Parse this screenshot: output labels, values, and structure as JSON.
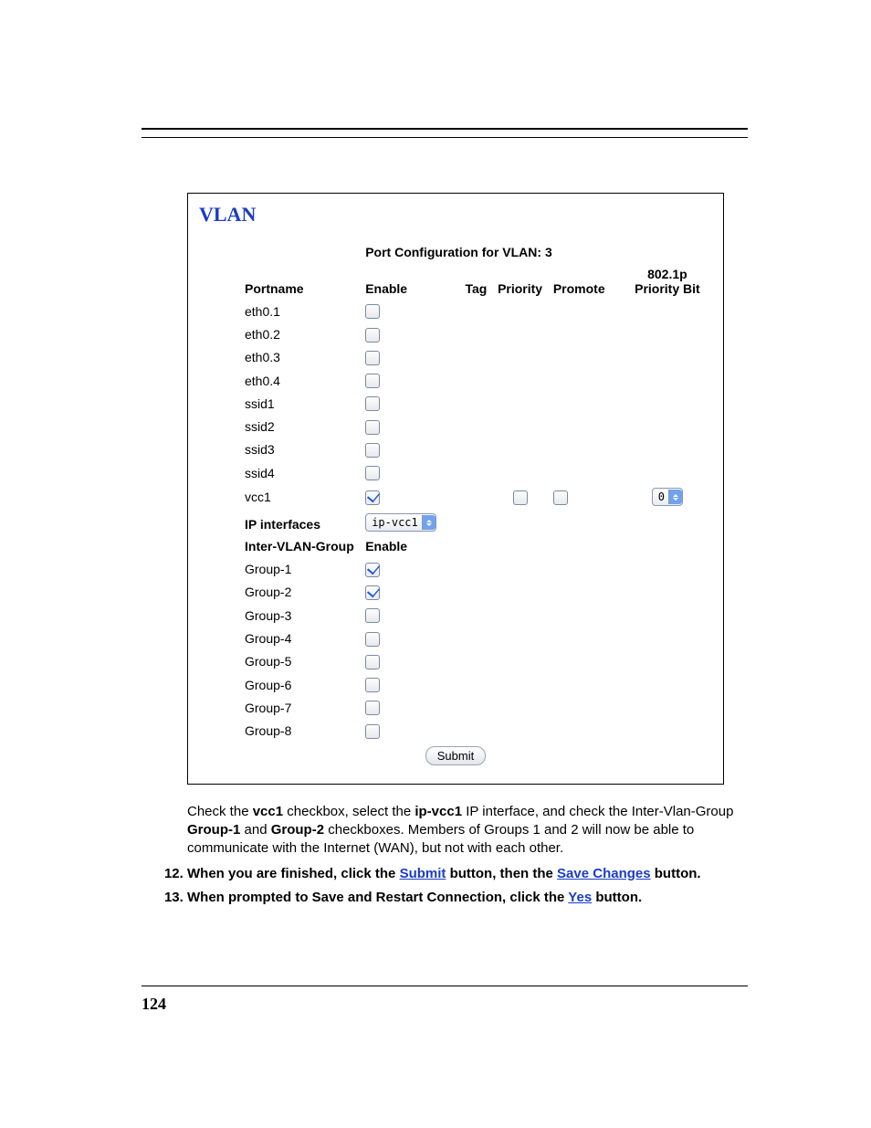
{
  "panel": {
    "title": "VLAN",
    "port_config_caption": "Port Configuration for VLAN: 3",
    "headers": {
      "portname": "Portname",
      "enable": "Enable",
      "tag": "Tag",
      "priority": "Priority",
      "promote": "Promote",
      "bit": "802.1p Priority Bit"
    },
    "ports": [
      {
        "name": "eth0.1",
        "enable": false
      },
      {
        "name": "eth0.2",
        "enable": false
      },
      {
        "name": "eth0.3",
        "enable": false
      },
      {
        "name": "eth0.4",
        "enable": false
      },
      {
        "name": "ssid1",
        "enable": false
      },
      {
        "name": "ssid2",
        "enable": false
      },
      {
        "name": "ssid3",
        "enable": false
      },
      {
        "name": "ssid4",
        "enable": false
      },
      {
        "name": "vcc1",
        "enable": true,
        "tag": false,
        "promote": false,
        "bit": "0"
      }
    ],
    "ip_interfaces_label": "IP interfaces",
    "ip_interface_value": "ip-vcc1",
    "inter_vlan_label": "Inter-VLAN-Group",
    "inter_vlan_enable_header": "Enable",
    "groups": [
      {
        "name": "Group-1",
        "enable": true
      },
      {
        "name": "Group-2",
        "enable": true
      },
      {
        "name": "Group-3",
        "enable": false
      },
      {
        "name": "Group-4",
        "enable": false
      },
      {
        "name": "Group-5",
        "enable": false
      },
      {
        "name": "Group-6",
        "enable": false
      },
      {
        "name": "Group-7",
        "enable": false
      },
      {
        "name": "Group-8",
        "enable": false
      }
    ],
    "submit_label": "Submit"
  },
  "body_paragraph": {
    "t1": "Check the ",
    "b1": "vcc1",
    "t2": " checkbox, select the ",
    "b2": "ip-vcc1",
    "t3": " IP interface, and check the Inter-Vlan-Group ",
    "b3": "Group-1",
    "t4": " and ",
    "b4": "Group-2",
    "t5": " checkboxes. Members of Groups 1 and 2 will now be able to communicate with the Internet (WAN), but not with each other."
  },
  "steps": {
    "s12a": "When you are finished, click the ",
    "s12_link1": "Submit",
    "s12b": " button, then the ",
    "s12_link2": "Save Changes",
    "s12c": " button.",
    "s13a": "When prompted to Save and Restart Connection, click the ",
    "s13_link1": "Yes",
    "s13b": " button."
  },
  "page_number": "124"
}
